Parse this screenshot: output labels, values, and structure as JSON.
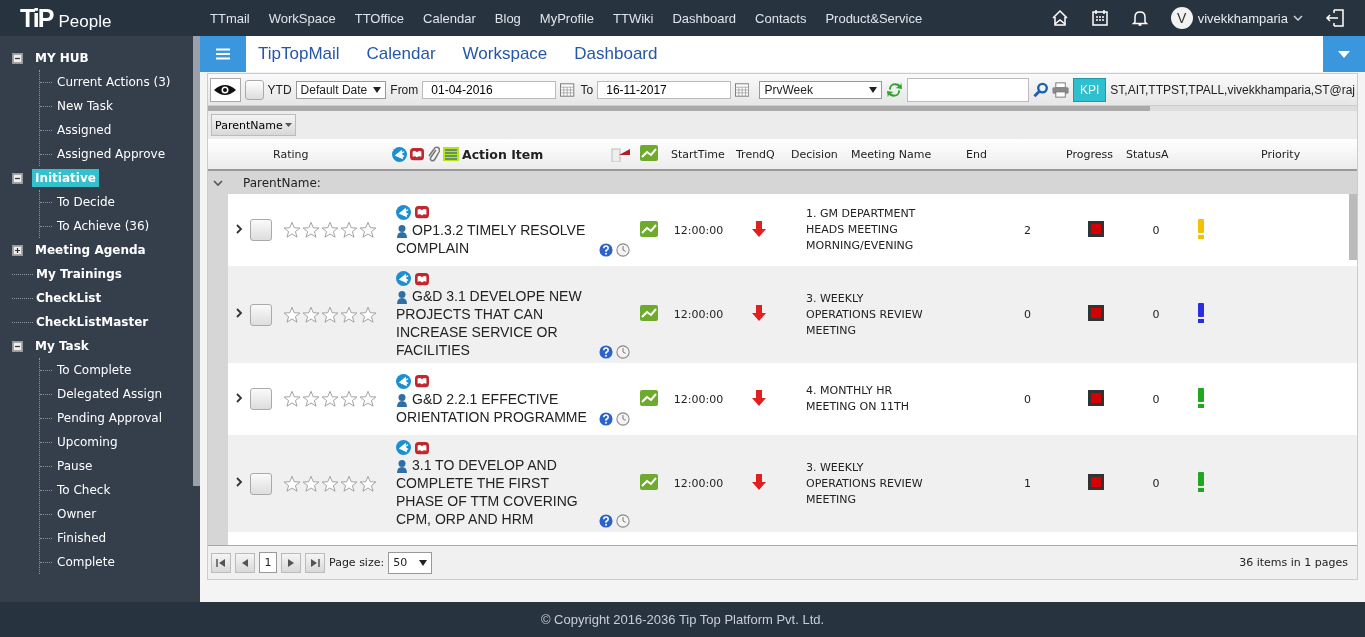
{
  "topbar": {
    "logo": "TiP",
    "app_name": "People",
    "nav": [
      "TTmail",
      "WorkSpace",
      "TTOffice",
      "Calendar",
      "Blog",
      "MyProfile",
      "TTWiki",
      "Dashboard",
      "Contacts",
      "Product&Service"
    ],
    "user": {
      "initial": "V",
      "name": "vivekkhamparia"
    }
  },
  "sidebar": {
    "items": [
      {
        "label": "MY HUB",
        "selected": false,
        "expanded": true,
        "children": [
          {
            "label": "Current Actions (3)",
            "selected": false
          },
          {
            "label": "New Task",
            "selected": false
          },
          {
            "label": "Assigned",
            "selected": false
          },
          {
            "label": "Assigned Approve",
            "selected": false
          }
        ]
      },
      {
        "label": "Initiative",
        "selected": true,
        "expanded": true,
        "children": [
          {
            "label": "To Decide",
            "selected": false
          },
          {
            "label": "To Achieve (36)",
            "selected": false
          }
        ]
      },
      {
        "label": "Meeting Agenda",
        "selected": false,
        "expanded": false
      },
      {
        "label": "My Trainings",
        "selected": false
      },
      {
        "label": "CheckList",
        "selected": false
      },
      {
        "label": "CheckListMaster",
        "selected": false
      },
      {
        "label": "My Task",
        "selected": false,
        "expanded": true,
        "children": [
          {
            "label": "To Complete",
            "selected": false
          },
          {
            "label": "Delegated Assign",
            "selected": false
          },
          {
            "label": "Pending Approval",
            "selected": false
          },
          {
            "label": "Upcoming",
            "selected": false
          },
          {
            "label": "Pause",
            "selected": false
          },
          {
            "label": "To Check",
            "selected": false
          },
          {
            "label": "Owner",
            "selected": false
          },
          {
            "label": "Finished",
            "selected": false
          },
          {
            "label": "Complete",
            "selected": false
          }
        ]
      }
    ]
  },
  "subnav": {
    "links": [
      "TipTopMail",
      "Calendar",
      "Workspace",
      "Dashboard"
    ]
  },
  "toolbar": {
    "ytd_checked": false,
    "ytd_label": "YTD",
    "date_type": "Default Date",
    "from_label": "From",
    "from": "01-04-2016",
    "to_label": "To",
    "to": "16-11-2017",
    "period": "PrvWeek",
    "kpi": "KPI",
    "filter_text": "ST,AIT,TTPST,TPALL,vivekkhamparia,ST@raj"
  },
  "group_panel": {
    "button": "ParentName"
  },
  "grid": {
    "columns": [
      "Rating",
      "Action Item",
      "StartTime",
      "TrendQ",
      "Decision",
      "Meeting Name",
      "End",
      "Progress",
      "StatusA",
      "Priority"
    ],
    "group_label": "ParentName:",
    "group_expanded": true,
    "rows": [
      {
        "expanded": false,
        "checked": false,
        "stars": 0,
        "action": "OP1.3.2 TIMELY RESOLVE COMPLAIN",
        "start": "12:00:00",
        "meeting": "1. GM DEPARTMENT HEADS MEETING MORNING/EVENING",
        "end": "2",
        "status_a": "0",
        "color": "#f2c200"
      },
      {
        "expanded": false,
        "checked": false,
        "stars": 0,
        "action": "G&D 3.1 DEVELOPE NEW PROJECTS THAT CAN INCREASE SERVICE OR FACILITIES",
        "start": "12:00:00",
        "meeting": "3. WEEKLY OPERATIONS REVIEW MEETING",
        "end": "0",
        "status_a": "0",
        "color": "#2a2ee0"
      },
      {
        "expanded": false,
        "checked": false,
        "stars": 0,
        "action": "G&D 2.2.1 EFFECTIVE ORIENTATION PROGRAMME",
        "start": "12:00:00",
        "meeting": "4. MONTHLY HR MEETING ON 11TH",
        "end": "0",
        "status_a": "0",
        "color": "#1fa81f"
      },
      {
        "expanded": false,
        "checked": false,
        "stars": 0,
        "action": "3.1 TO DEVELOP AND COMPLETE THE FIRST PHASE OF TTM COVERING CPM, ORP AND HRM",
        "start": "12:00:00",
        "meeting": "3. WEEKLY OPERATIONS REVIEW MEETING",
        "end": "1",
        "status_a": "0",
        "color": "#1fa81f"
      }
    ]
  },
  "pager": {
    "page": "1",
    "page_size_label": "Page size:",
    "page_size": "50",
    "summary": "36 items in 1 pages"
  },
  "footer": "© Copyright 2016-2036 Tip Top Platform Pvt. Ltd."
}
